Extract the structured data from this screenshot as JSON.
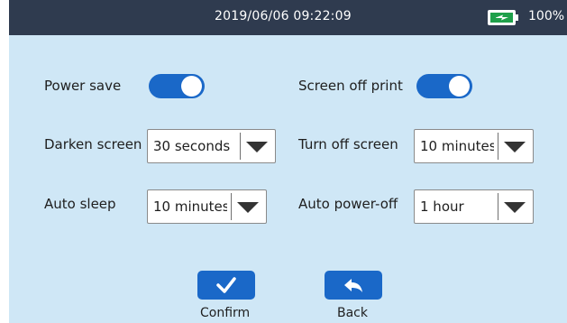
{
  "status": {
    "datetime": "2019/06/06 09:22:09",
    "battery_percent": "100%",
    "battery_color": "#1fa04a"
  },
  "settings": {
    "power_save": {
      "label": "Power save",
      "on": true
    },
    "screen_off_print": {
      "label": "Screen off print",
      "on": true
    },
    "darken_screen": {
      "label": "Darken screen",
      "value": "30 seconds"
    },
    "turn_off_screen": {
      "label": "Turn off screen",
      "value": "10 minutes"
    },
    "auto_sleep": {
      "label": "Auto sleep",
      "value": "10 minutes"
    },
    "auto_power_off": {
      "label": "Auto power-off",
      "value": "1 hour"
    }
  },
  "actions": {
    "confirm_label": "Confirm",
    "back_label": "Back"
  },
  "colors": {
    "accent": "#1a68c8",
    "background": "#cfe7f6",
    "statusbar": "#2f3b4f"
  },
  "icons": {
    "battery": "battery-charging-icon",
    "confirm": "checkmark-icon",
    "back": "back-arrow-icon",
    "dropdown": "triangle-down-icon"
  }
}
